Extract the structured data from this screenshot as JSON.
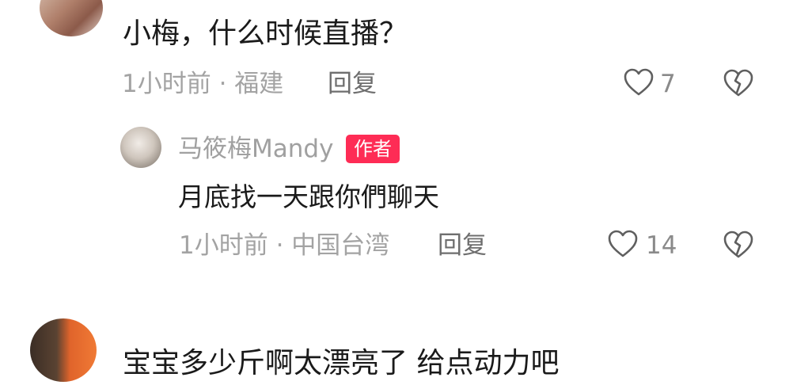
{
  "comments": [
    {
      "text": "小梅，什么时候直播？",
      "meta": "1小时前 · 福建",
      "reply_label": "回复",
      "like_count": "7"
    },
    {
      "author": "马筱梅Mandy",
      "badge": "作者",
      "text": "月底找一天跟你們聊天",
      "meta": "1小时前 · 中国台湾",
      "reply_label": "回复",
      "like_count": "14"
    },
    {
      "text": "宝宝多少斤啊太漂亮了 给点动力吧"
    }
  ],
  "icons": {
    "like": "heart-outline-icon",
    "dislike": "broken-heart-icon"
  },
  "colors": {
    "author_badge": "#fe2c55",
    "meta_text": "#a3a3a3"
  }
}
